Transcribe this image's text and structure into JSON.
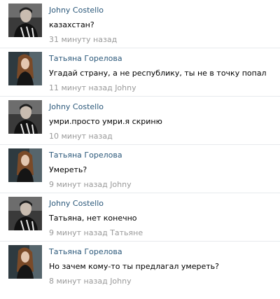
{
  "comments": [
    {
      "author": "Johny Costello",
      "text": "казахстан?",
      "time": "31 минуту назад",
      "reply_to": "",
      "avatar": "male"
    },
    {
      "author": "Татьяна Горелова",
      "text": "Угадай страну, а не республику, ты не в точку попал",
      "time": "11 минут назад",
      "reply_to": "Johny",
      "avatar": "female"
    },
    {
      "author": "Johny Costello",
      "text": "умри.просто умри.я скриню",
      "time": "10 минут назад",
      "reply_to": "",
      "avatar": "male"
    },
    {
      "author": "Татьяна Горелова",
      "text": "Умереть?",
      "time": "9 минут назад",
      "reply_to": "Johny",
      "avatar": "female"
    },
    {
      "author": "Johny Costello",
      "text": "Татьяна, нет конечно",
      "time": "9 минут назад",
      "reply_to": "Татьяне",
      "avatar": "male"
    },
    {
      "author": "Татьяна Горелова",
      "text": "Но зачем кому-то ты предлагал умереть?",
      "time": "8 минут назад",
      "reply_to": "Johny",
      "avatar": "female"
    }
  ]
}
